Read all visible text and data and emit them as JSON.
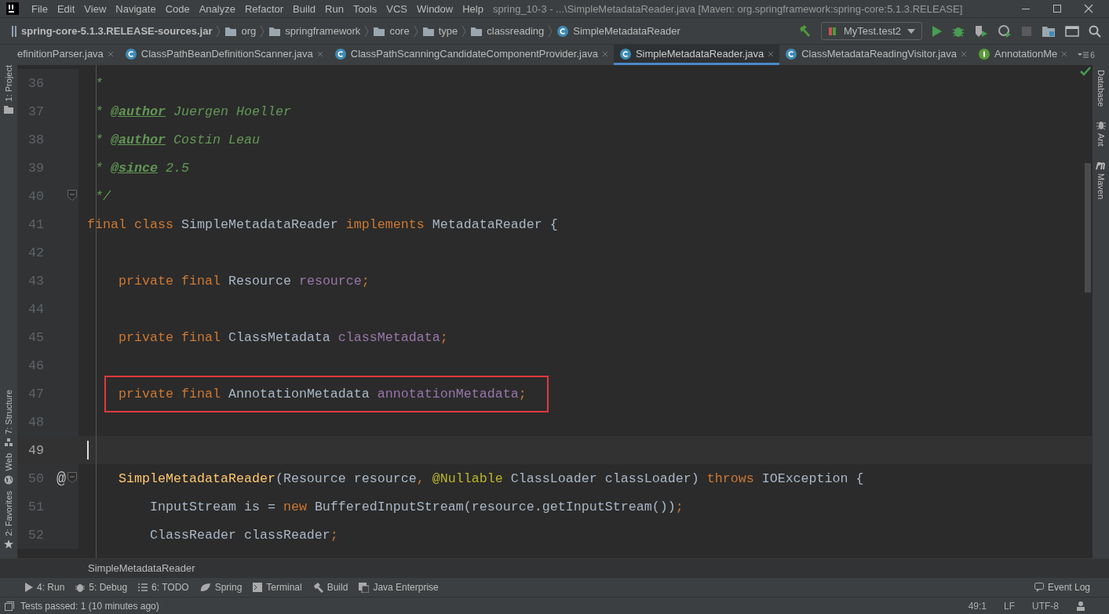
{
  "window": {
    "title": "spring_10-3 - ...\\SimpleMetadataReader.java [Maven: org.springframework:spring-core:5.1.3.RELEASE]"
  },
  "menu": [
    "File",
    "Edit",
    "View",
    "Navigate",
    "Code",
    "Analyze",
    "Refactor",
    "Build",
    "Run",
    "Tools",
    "VCS",
    "Window",
    "Help"
  ],
  "navigation": {
    "crumbs": [
      {
        "kind": "jar",
        "label": "spring-core-5.1.3.RELEASE-sources.jar"
      },
      {
        "kind": "folder",
        "label": "org"
      },
      {
        "kind": "folder",
        "label": "springframework"
      },
      {
        "kind": "folder",
        "label": "core"
      },
      {
        "kind": "folder",
        "label": "type"
      },
      {
        "kind": "folder",
        "label": "classreading"
      },
      {
        "kind": "class",
        "label": "SimpleMetadataReader"
      }
    ],
    "run_config": "MyTest.test2"
  },
  "tabs": [
    {
      "label": "efinitionParser.java",
      "kind": "plain",
      "selected": false
    },
    {
      "label": "ClassPathBeanDefinitionScanner.java",
      "kind": "class",
      "selected": false
    },
    {
      "label": "ClassPathScanningCandidateComponentProvider.java",
      "kind": "class",
      "selected": false
    },
    {
      "label": "SimpleMetadataReader.java",
      "kind": "class",
      "selected": true
    },
    {
      "label": "ClassMetadataReadingVisitor.java",
      "kind": "class",
      "selected": false
    },
    {
      "label": "AnnotationMe",
      "kind": "interface",
      "selected": false
    }
  ],
  "tab_overflow": "6",
  "left_tools": [
    {
      "label": "1: Project",
      "kind": "project"
    },
    {
      "label": "7: Structure",
      "kind": "structure"
    },
    {
      "label": "Web",
      "kind": "web"
    },
    {
      "label": "2: Favorites",
      "kind": "favorites"
    }
  ],
  "right_tools": [
    {
      "label": "Database",
      "kind": "database"
    },
    {
      "label": "Ant",
      "kind": "ant"
    },
    {
      "label": "Maven",
      "kind": "maven"
    }
  ],
  "editor": {
    "lines": [
      {
        "number": "36",
        "current": false,
        "kind": "code",
        "tokens": [
          {
            "kind": "comment",
            "text": " *"
          }
        ]
      },
      {
        "number": "37",
        "current": false,
        "kind": "code",
        "tokens": [
          {
            "kind": "comment",
            "text": " * "
          },
          {
            "kind": "tag",
            "text": "@author"
          },
          {
            "kind": "comment",
            "text": " Juergen Hoeller"
          }
        ]
      },
      {
        "number": "38",
        "current": false,
        "kind": "code",
        "tokens": [
          {
            "kind": "comment",
            "text": " * "
          },
          {
            "kind": "tag",
            "text": "@author"
          },
          {
            "kind": "comment",
            "text": " Costin Leau"
          }
        ]
      },
      {
        "number": "39",
        "current": false,
        "kind": "code",
        "tokens": [
          {
            "kind": "comment",
            "text": " * "
          },
          {
            "kind": "tag",
            "text": "@since"
          },
          {
            "kind": "comment",
            "text": " 2.5"
          }
        ]
      },
      {
        "number": "40",
        "current": false,
        "kind": "code",
        "markers": [
          {
            "kind": "fold"
          }
        ],
        "tokens": [
          {
            "kind": "comment",
            "text": " */"
          }
        ]
      },
      {
        "number": "41",
        "current": false,
        "kind": "code",
        "tokens": [
          {
            "kind": "keyword",
            "text": "final class "
          },
          {
            "kind": "plain",
            "text": "SimpleMetadataReader "
          },
          {
            "kind": "keyword",
            "text": "implements "
          },
          {
            "kind": "plain",
            "text": "MetadataReader {"
          }
        ]
      },
      {
        "number": "42",
        "current": false,
        "kind": "code"
      },
      {
        "number": "43",
        "current": false,
        "kind": "code",
        "tokens": [
          {
            "kind": "keyword",
            "text": "    private final "
          },
          {
            "kind": "plain",
            "text": "Resource "
          },
          {
            "kind": "field",
            "text": "resource"
          },
          {
            "kind": "keyword",
            "text": ";"
          }
        ]
      },
      {
        "number": "44",
        "current": false,
        "kind": "code"
      },
      {
        "number": "45",
        "current": false,
        "kind": "code",
        "tokens": [
          {
            "kind": "keyword",
            "text": "    private final "
          },
          {
            "kind": "plain",
            "text": "ClassMetadata "
          },
          {
            "kind": "field",
            "text": "classMetadata"
          },
          {
            "kind": "keyword",
            "text": ";"
          }
        ]
      },
      {
        "number": "46",
        "current": false,
        "kind": "code"
      },
      {
        "number": "47",
        "current": false,
        "kind": "boxed",
        "tokens": [
          {
            "kind": "keyword",
            "text": "    private final "
          },
          {
            "kind": "plain",
            "text": "AnnotationMetadata "
          },
          {
            "kind": "field",
            "text": "annotationMetadata"
          },
          {
            "kind": "keyword",
            "text": ";"
          }
        ]
      },
      {
        "number": "48",
        "current": false,
        "kind": "code"
      },
      {
        "number": "49",
        "current": true,
        "kind": "code"
      },
      {
        "number": "50",
        "current": false,
        "kind": "code",
        "markers": [
          {
            "kind": "implements",
            "text": "@"
          },
          {
            "kind": "fold"
          }
        ],
        "tokens": [
          {
            "kind": "method",
            "text": "    SimpleMetadataReader"
          },
          {
            "kind": "plain",
            "text": "(Resource resource"
          },
          {
            "kind": "keyword",
            "text": ", "
          },
          {
            "kind": "annotation",
            "text": "@Nullable "
          },
          {
            "kind": "plain",
            "text": "ClassLoader classLoader) "
          },
          {
            "kind": "keyword",
            "text": "throws "
          },
          {
            "kind": "plain",
            "text": "IOException {"
          }
        ]
      },
      {
        "number": "51",
        "current": false,
        "kind": "code",
        "tokens": [
          {
            "kind": "plain",
            "text": "        InputStream is = "
          },
          {
            "kind": "keyword",
            "text": "new "
          },
          {
            "kind": "plain",
            "text": "BufferedInputStream(resource.getInputStream())"
          },
          {
            "kind": "keyword",
            "text": ";"
          }
        ]
      },
      {
        "number": "52",
        "current": false,
        "kind": "code",
        "tokens": [
          {
            "kind": "plain",
            "text": "        ClassReader classReader"
          },
          {
            "kind": "keyword",
            "text": ";"
          }
        ]
      }
    ],
    "breadcrumb": "SimpleMetadataReader"
  },
  "tool_windows": [
    {
      "label": "4: Run",
      "kind": "run"
    },
    {
      "label": "5: Debug",
      "kind": "debug"
    },
    {
      "label": "6: TODO",
      "kind": "todo"
    },
    {
      "label": "Spring",
      "kind": "spring"
    },
    {
      "label": "Terminal",
      "kind": "terminal"
    },
    {
      "label": "Build",
      "kind": "build"
    },
    {
      "label": "Java Enterprise",
      "kind": "enterprise"
    }
  ],
  "event_log": "Event Log",
  "status_bar": {
    "message": "Tests passed: 1 (10 minutes ago)",
    "position": "49:1",
    "line_separator": "LF",
    "encoding": "UTF-8"
  }
}
